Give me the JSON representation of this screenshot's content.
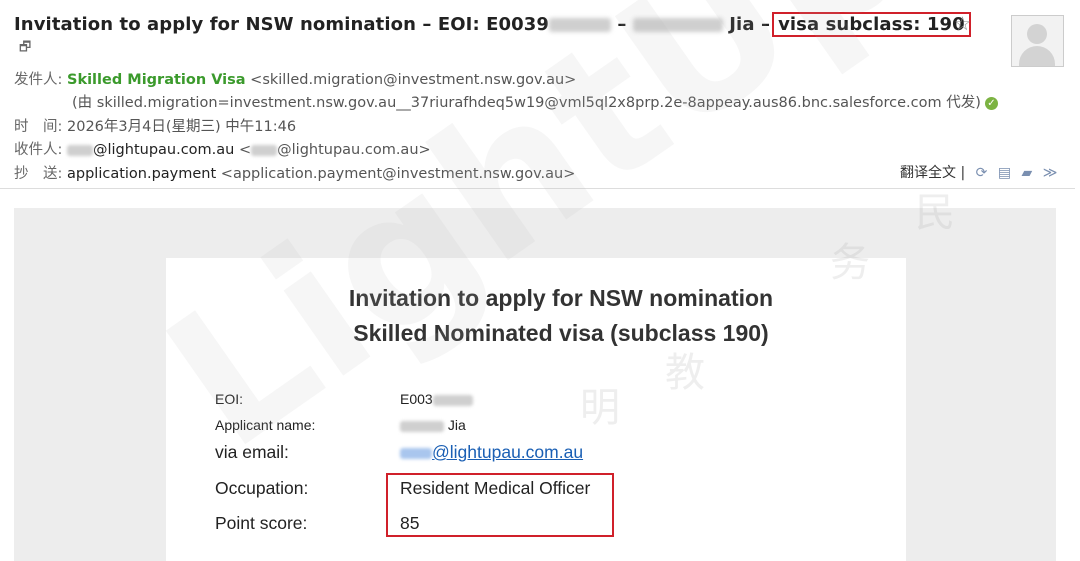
{
  "email": {
    "subject_prefix": "Invitation to apply for NSW nomination – EOI: E0039",
    "subject_mid": "–",
    "subject_name": "Jia",
    "subject_sep": "–",
    "subject_highlight": "visa subclass: 190",
    "from_label": "发件人:",
    "from_name": "Skilled Migration Visa",
    "from_address": "<skilled.migration@investment.nsw.gov.au>",
    "on_behalf": "(由 skilled.migration=investment.nsw.gov.au__37riurafhdeq5w19@vml5ql2x8prp.2e-8appeay.aus86.bnc.salesforce.com 代发)",
    "time_label": "时　间:",
    "time_value": "2026年3月4日(星期三) 中午11:46",
    "to_label": "收件人:",
    "to_value": "@lightupau.com.au",
    "to_address_open": "<",
    "to_address": "@lightupau.com.au>",
    "cc_label": "抄　送:",
    "cc_name": "application.payment",
    "cc_address": "<application.payment@investment.nsw.gov.au>"
  },
  "toolbar": {
    "translate_label": "翻译全文",
    "separator": "|",
    "icons": [
      "refresh-icon",
      "note-icon",
      "print-icon",
      "more-chevron-icon"
    ]
  },
  "letter": {
    "title_line1": "Invitation to apply for NSW nomination",
    "title_line2": "Skilled Nominated visa (subclass 190)",
    "eoi_label": "EOI:",
    "eoi_value": "E003",
    "applicant_label": "Applicant name:",
    "applicant_value": "Jia",
    "email_label": "via email:",
    "email_value": "@lightupau.com.au",
    "occupation_label": "Occupation:",
    "occupation_value": "Resident Medical Officer",
    "points_label": "Point score:",
    "points_value": "85"
  },
  "watermark": {
    "text": "LightUp",
    "chars": [
      "明",
      "教",
      "务",
      "民"
    ]
  },
  "colors": {
    "highlight_border": "#d0202a",
    "sender_green": "#3b9a2c",
    "link_blue": "#1a5fb4"
  }
}
